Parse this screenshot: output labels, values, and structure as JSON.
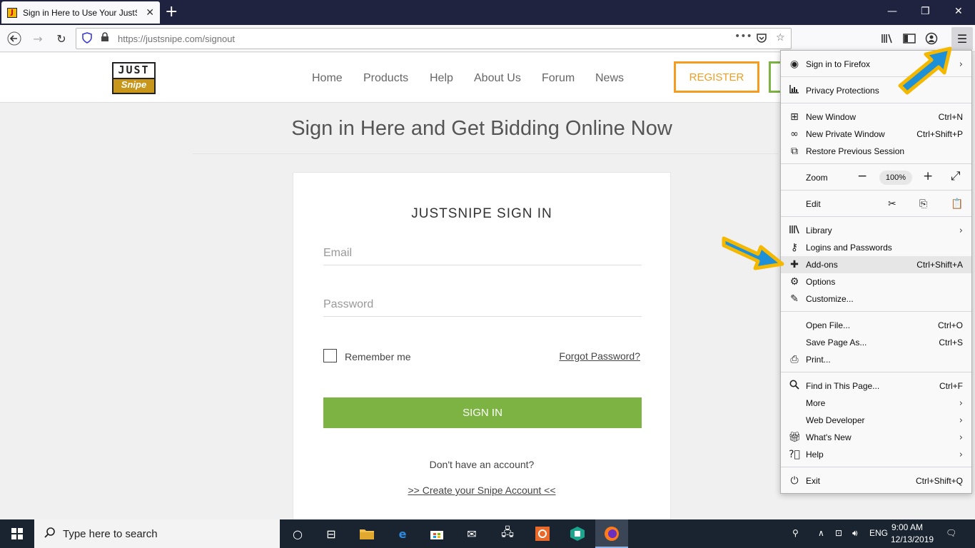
{
  "browser": {
    "tab_title": "Sign in Here to Use Your JustSn",
    "tab_favicon_letter": "J",
    "url_host": "https://justsnipe.com",
    "url_path": "/signout"
  },
  "site": {
    "logo_top": "JUST",
    "logo_bottom": "Snipe",
    "nav": [
      "Home",
      "Products",
      "Help",
      "About Us",
      "Forum",
      "News"
    ],
    "register_label": "REGISTER",
    "page_heading": "Sign in Here and Get Bidding Online Now",
    "card_title": "JUSTSNIPE SIGN IN",
    "email_placeholder": "Email",
    "password_placeholder": "Password",
    "remember_label": "Remember me",
    "forgot_label": "Forgot Password?",
    "signin_label": "SIGN IN",
    "no_account": "Don't have an account?",
    "create_account": ">> Create your Snipe Account <<"
  },
  "menu": {
    "sign_in": "Sign in to Firefox",
    "privacy": "Privacy Protections",
    "new_window": "New Window",
    "new_window_sc": "Ctrl+N",
    "private_window": "New Private Window",
    "private_window_sc": "Ctrl+Shift+P",
    "restore": "Restore Previous Session",
    "zoom": "Zoom",
    "zoom_value": "100%",
    "edit": "Edit",
    "library": "Library",
    "logins": "Logins and Passwords",
    "addons": "Add-ons",
    "addons_sc": "Ctrl+Shift+A",
    "options": "Options",
    "customize": "Customize...",
    "open_file": "Open File...",
    "open_file_sc": "Ctrl+O",
    "save_page": "Save Page As...",
    "save_page_sc": "Ctrl+S",
    "print": "Print...",
    "find": "Find in This Page...",
    "find_sc": "Ctrl+F",
    "more": "More",
    "web_dev": "Web Developer",
    "whats_new": "What's New",
    "help": "Help",
    "exit": "Exit",
    "exit_sc": "Ctrl+Shift+Q"
  },
  "taskbar": {
    "search_placeholder": "Type here to search",
    "lang": "ENG",
    "time": "9:00 AM",
    "date": "12/13/2019"
  },
  "colors": {
    "accent_green": "#7cb342",
    "register_orange": "#f39c1f",
    "annotation_arrow_fill": "#1e90d8",
    "annotation_arrow_border": "#f5b800"
  }
}
